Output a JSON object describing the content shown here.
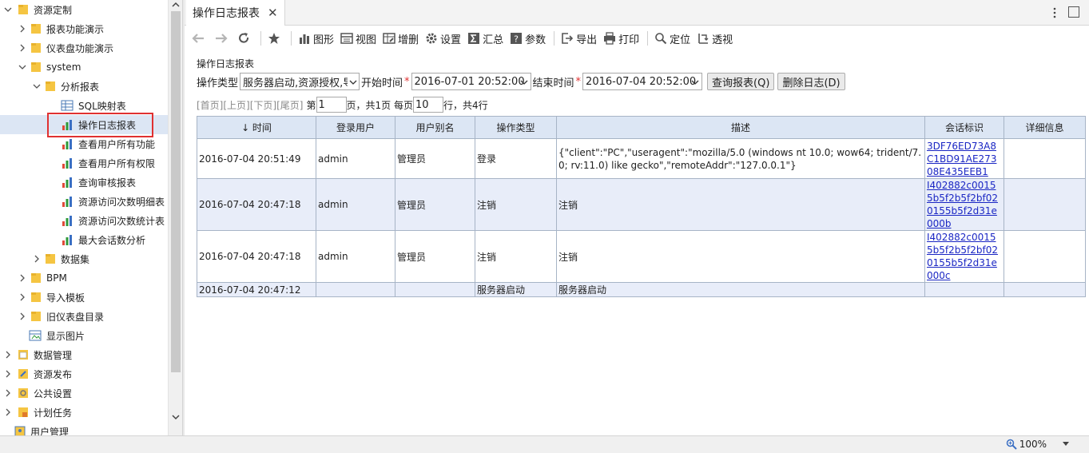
{
  "sidebar": {
    "items": [
      {
        "label": "资源定制"
      },
      {
        "label": "报表功能演示"
      },
      {
        "label": "仪表盘功能演示"
      },
      {
        "label": "system"
      },
      {
        "label": "分析报表"
      },
      {
        "label": "SQL映射表"
      },
      {
        "label": "操作日志报表"
      },
      {
        "label": "查看用户所有功能"
      },
      {
        "label": "查看用户所有权限"
      },
      {
        "label": "查询审核报表"
      },
      {
        "label": "资源访问次数明细表"
      },
      {
        "label": "资源访问次数统计表"
      },
      {
        "label": "最大会话数分析"
      },
      {
        "label": "数据集"
      },
      {
        "label": "BPM"
      },
      {
        "label": "导入模板"
      },
      {
        "label": "旧仪表盘目录"
      },
      {
        "label": "显示图片"
      },
      {
        "label": "数据管理"
      },
      {
        "label": "资源发布"
      },
      {
        "label": "公共设置"
      },
      {
        "label": "计划任务"
      },
      {
        "label": "用户管理"
      }
    ]
  },
  "tab": {
    "title": "操作日志报表",
    "close": "✕"
  },
  "toolbar": {
    "chart": "图形",
    "view": "视图",
    "edit": "增删",
    "settings": "设置",
    "summary": "汇总",
    "params": "参数",
    "export": "导出",
    "print": "打印",
    "locate": "定位",
    "pivot": "透视"
  },
  "report": {
    "title": "操作日志报表",
    "op_type_label": "操作类型",
    "op_type_value": "服务器启动,资源授权,导",
    "start_label": "开始时间",
    "start_value": "2016-07-01 20:52:00",
    "end_label": "结束时间",
    "end_value": "2016-07-04 20:52:00",
    "query_button": "查询报表(Q)",
    "delete_button": "删除日志(D)",
    "required_mark": "*"
  },
  "pager": {
    "first": "[首页]",
    "prev": "[上页]",
    "next": "[下页]",
    "last": "[尾页]",
    "page_prefix": "第",
    "page_value": "1",
    "page_suffix": "页，共1页 每页",
    "size_value": "10",
    "size_suffix": "行，共4行"
  },
  "table": {
    "headers": [
      "↓ 时间",
      "登录用户",
      "用户别名",
      "操作类型",
      "描述",
      "会话标识",
      "详细信息"
    ],
    "rows": [
      {
        "time": "2016-07-04 20:51:49",
        "user": "admin",
        "alias": "管理员",
        "type": "登录",
        "desc": "{\"client\":\"PC\",\"useragent\":\"mozilla/5.0 (windows nt 10.0; wow64; trident/7.0; rv:11.0) like gecko\",\"remoteAddr\":\"127.0.0.1\"}",
        "session": "3DF76ED73A8C1BD91AE27308E435EEB1",
        "detail": ""
      },
      {
        "time": "2016-07-04 20:47:18",
        "user": "admin",
        "alias": "管理员",
        "type": "注销",
        "desc": "注销",
        "session": "I402882c00155b5f2b5f2bf020155b5f2d31e000b",
        "detail": ""
      },
      {
        "time": "2016-07-04 20:47:18",
        "user": "admin",
        "alias": "管理员",
        "type": "注销",
        "desc": "注销",
        "session": "I402882c00155b5f2b5f2bf020155b5f2d31e000c",
        "detail": ""
      },
      {
        "time": "2016-07-04 20:47:12",
        "user": "",
        "alias": "",
        "type": "服务器启动",
        "desc": "服务器启动",
        "session": "",
        "detail": ""
      }
    ]
  },
  "status": {
    "zoom": "100%"
  },
  "colors": {
    "selected_row": "#dce6f4",
    "highlight_box": "#e03131",
    "link": "#1a26c4",
    "folder": "#f5c542"
  }
}
